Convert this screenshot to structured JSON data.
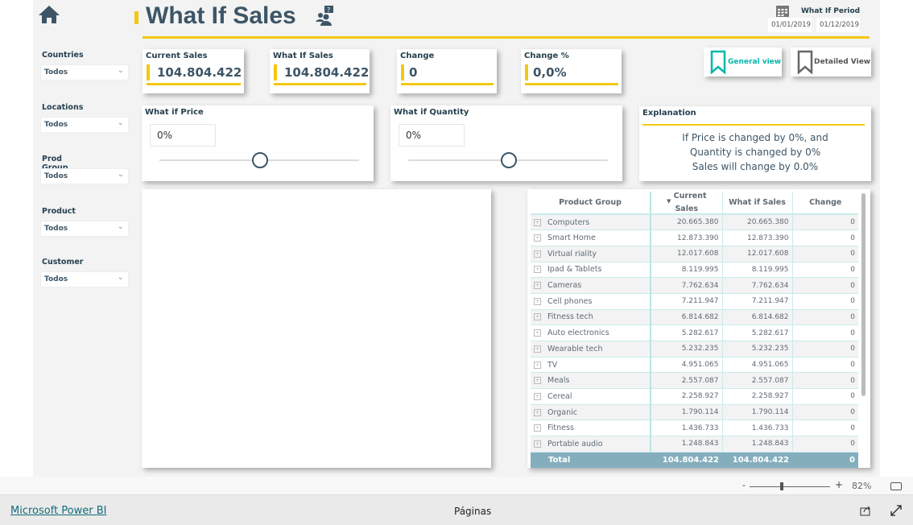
{
  "header": {
    "title": "What If Sales",
    "home_icon": "home-icon",
    "help_icon": "people-question-icon"
  },
  "period": {
    "label": "What If Period",
    "start": "01/01/2019",
    "end": "01/12/2019"
  },
  "bookmarks": {
    "general": "General view",
    "detailed": "Detailed View"
  },
  "filters": [
    {
      "label": "Countries",
      "value": "Todos"
    },
    {
      "label": "Locations",
      "value": "Todos"
    },
    {
      "label": "Prod Group",
      "value": "Todos"
    },
    {
      "label": "Product",
      "value": "Todos"
    },
    {
      "label": "Customer",
      "value": "Todos"
    }
  ],
  "kpis": [
    {
      "label": "Current Sales",
      "value": "104.804.422"
    },
    {
      "label": "What If Sales",
      "value": "104.804.422"
    },
    {
      "label": "Change",
      "value": "0"
    },
    {
      "label": "Change %",
      "value": "0,0%"
    }
  ],
  "sliders": [
    {
      "label": "What if Price",
      "value": "0%",
      "level": 0.5
    },
    {
      "label": "What if Quantity",
      "value": "0%",
      "level": 0.5
    }
  ],
  "explanation": {
    "title": "Explanation",
    "line1": "If Price is changed by 0%, and",
    "line2": "Quantity is changed by 0%",
    "line3": "Sales will change by 0.0%"
  },
  "table": {
    "headers": [
      "Product Group",
      "Current Sales",
      "What if Sales",
      "Change"
    ],
    "rows": [
      [
        "Computers",
        "20.665.380",
        "20.665.380",
        "0"
      ],
      [
        "Smart Home",
        "12.873.390",
        "12.873.390",
        "0"
      ],
      [
        "Virtual riality",
        "12.017.608",
        "12.017.608",
        "0"
      ],
      [
        "Ipad & Tablets",
        "8.119.995",
        "8.119.995",
        "0"
      ],
      [
        "Cameras",
        "7.762.634",
        "7.762.634",
        "0"
      ],
      [
        "Cell phones",
        "7.211.947",
        "7.211.947",
        "0"
      ],
      [
        "Fitness tech",
        "6.814.682",
        "6.814.682",
        "0"
      ],
      [
        "Auto electronics",
        "5.282.617",
        "5.282.617",
        "0"
      ],
      [
        "Wearable tech",
        "5.232.235",
        "5.232.235",
        "0"
      ],
      [
        "TV",
        "4.951.065",
        "4.951.065",
        "0"
      ],
      [
        "Meals",
        "2.557.087",
        "2.557.087",
        "0"
      ],
      [
        "Cereal",
        "2.258.927",
        "2.258.927",
        "0"
      ],
      [
        "Organic",
        "1.790.114",
        "1.790.114",
        "0"
      ],
      [
        "Fitness",
        "1.436.733",
        "1.436.733",
        "0"
      ],
      [
        "Portable audio",
        "1.248.843",
        "1.248.843",
        "0"
      ]
    ],
    "total": [
      "Total",
      "104.804.422",
      "104.804.422",
      "0"
    ]
  },
  "zoom": {
    "minus": "-",
    "plus": "+",
    "value": "82%",
    "level": 0.45
  },
  "footer": {
    "brand": "Microsoft Power BI",
    "pages": "Páginas"
  },
  "colors": {
    "accent": "#f2c811",
    "teal": "#01b8aa",
    "dark": "#3d5566",
    "total_row": "#85aebd"
  }
}
